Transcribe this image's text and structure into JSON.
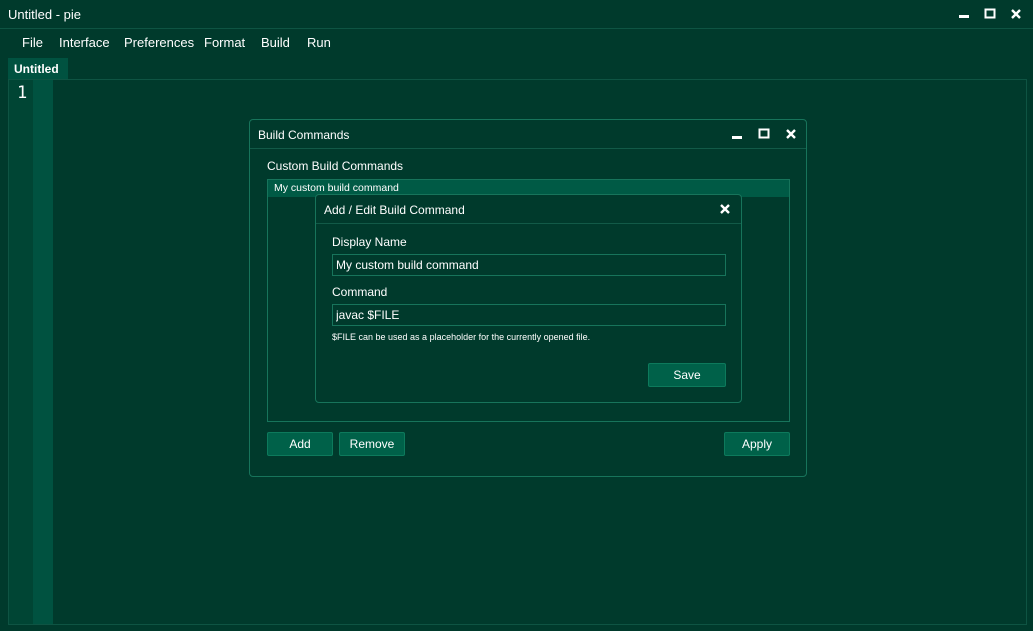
{
  "window": {
    "title": "Untitled - pie"
  },
  "menu": [
    "File",
    "Interface",
    "Preferences",
    "Format",
    "Build",
    "Run"
  ],
  "tab": {
    "label": "Untitled"
  },
  "editor": {
    "line_numbers": [
      "1"
    ]
  },
  "build_dialog": {
    "title": "Build Commands",
    "section_label": "Custom Build Commands",
    "commands": [
      "My custom build command"
    ],
    "add_label": "Add",
    "remove_label": "Remove",
    "apply_label": "Apply"
  },
  "edit_dialog": {
    "title": "Add / Edit Build Command",
    "display_name_label": "Display Name",
    "display_name_value": "My custom build command",
    "command_label": "Command",
    "command_value": "javac $FILE",
    "hint": "$FILE can be used as a placeholder for the currently opened file.",
    "save_label": "Save"
  },
  "colors": {
    "background": "#003a2c",
    "accent": "#006149",
    "border": "#17745b",
    "text": "#ffffff"
  },
  "icons": {
    "minimize": "minimize-icon",
    "maximize": "maximize-icon",
    "close": "close-icon"
  }
}
